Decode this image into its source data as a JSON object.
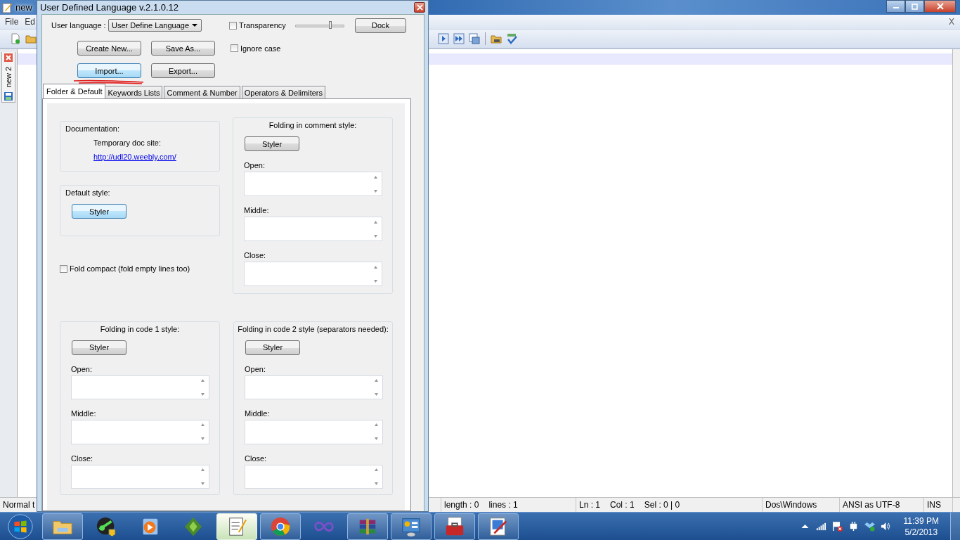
{
  "editor_window": {
    "title": "new",
    "menu": [
      "File",
      "Ed"
    ],
    "close_document": "X",
    "document_tab": {
      "label": "new 2"
    },
    "status_bar": [
      [
        "Normal t"
      ],
      [
        "length : 0",
        "lines : 1"
      ],
      [
        "Ln : 1",
        "Col : 1",
        "Sel : 0 | 0"
      ],
      [
        "Dos\\Windows"
      ],
      [
        "ANSI as UTF-8"
      ],
      [
        "INS"
      ]
    ]
  },
  "dialog": {
    "title": "User Defined Language v.2.1.0.12",
    "user_language": {
      "label": "User language :",
      "value": "User Define Language"
    },
    "transparency": {
      "label": "Transparency",
      "checked": false,
      "level": 0.72
    },
    "dock_button": "Dock",
    "ignore_case": {
      "label": "Ignore case",
      "checked": false
    },
    "buttons": [
      {
        "label": "Create New...",
        "highlighted": false
      },
      {
        "label": "Save As...",
        "highlighted": false
      },
      {
        "label": "Import...",
        "highlighted": true
      },
      {
        "label": "Export...",
        "highlighted": false
      }
    ],
    "tabs": [
      {
        "label": "Folder & Default",
        "selected": true
      },
      {
        "label": "Keywords Lists",
        "selected": false
      },
      {
        "label": "Comment & Number",
        "selected": false
      },
      {
        "label": "Operators & Delimiters",
        "selected": false
      }
    ],
    "documentation": {
      "title": "Documentation:",
      "text": "Temporary doc site:",
      "link": "http://udl20.weebly.com/"
    },
    "default_style": {
      "title": "Default style:",
      "button": {
        "label": "Styler",
        "highlighted": true
      }
    },
    "fold_compact": {
      "label": "Fold compact (fold empty lines too)",
      "checked": false
    },
    "comment_folding": {
      "title": "Folding in comment style:",
      "button": {
        "label": "Styler",
        "highlighted": false
      },
      "fields": [
        {
          "label": "Open:"
        },
        {
          "label": "Middle:"
        },
        {
          "label": "Close:"
        }
      ]
    },
    "code1_folding": {
      "title": "Folding in code 1 style:",
      "button": {
        "label": "Styler",
        "highlighted": false
      },
      "fields": [
        {
          "label": "Open:"
        },
        {
          "label": "Middle:"
        },
        {
          "label": "Close:"
        }
      ]
    },
    "code2_folding": {
      "title": "Folding in code 2 style (separators needed):",
      "button": {
        "label": "Styler",
        "highlighted": false
      },
      "fields": [
        {
          "label": "Open:"
        },
        {
          "label": "Middle:"
        },
        {
          "label": "Close:"
        }
      ]
    }
  },
  "taskbar": {
    "apps": [
      {
        "kind": "folder",
        "running": true,
        "selected": false
      },
      {
        "kind": "green-disc",
        "running": false,
        "selected": false
      },
      {
        "kind": "media-player",
        "running": false,
        "selected": false
      },
      {
        "kind": "tree",
        "running": false,
        "selected": false
      },
      {
        "kind": "notepad",
        "running": true,
        "selected": true
      },
      {
        "kind": "chrome",
        "running": true,
        "selected": false
      },
      {
        "kind": "infinity",
        "running": false,
        "selected": false
      },
      {
        "kind": "archive",
        "running": true,
        "selected": false
      },
      {
        "kind": "control-panel",
        "running": true,
        "selected": false
      },
      {
        "kind": "toolbox",
        "running": true,
        "selected": false
      },
      {
        "kind": "paint",
        "running": true,
        "selected": false
      }
    ],
    "clock": {
      "time": "11:39 PM",
      "date": "5/2/2013"
    }
  }
}
